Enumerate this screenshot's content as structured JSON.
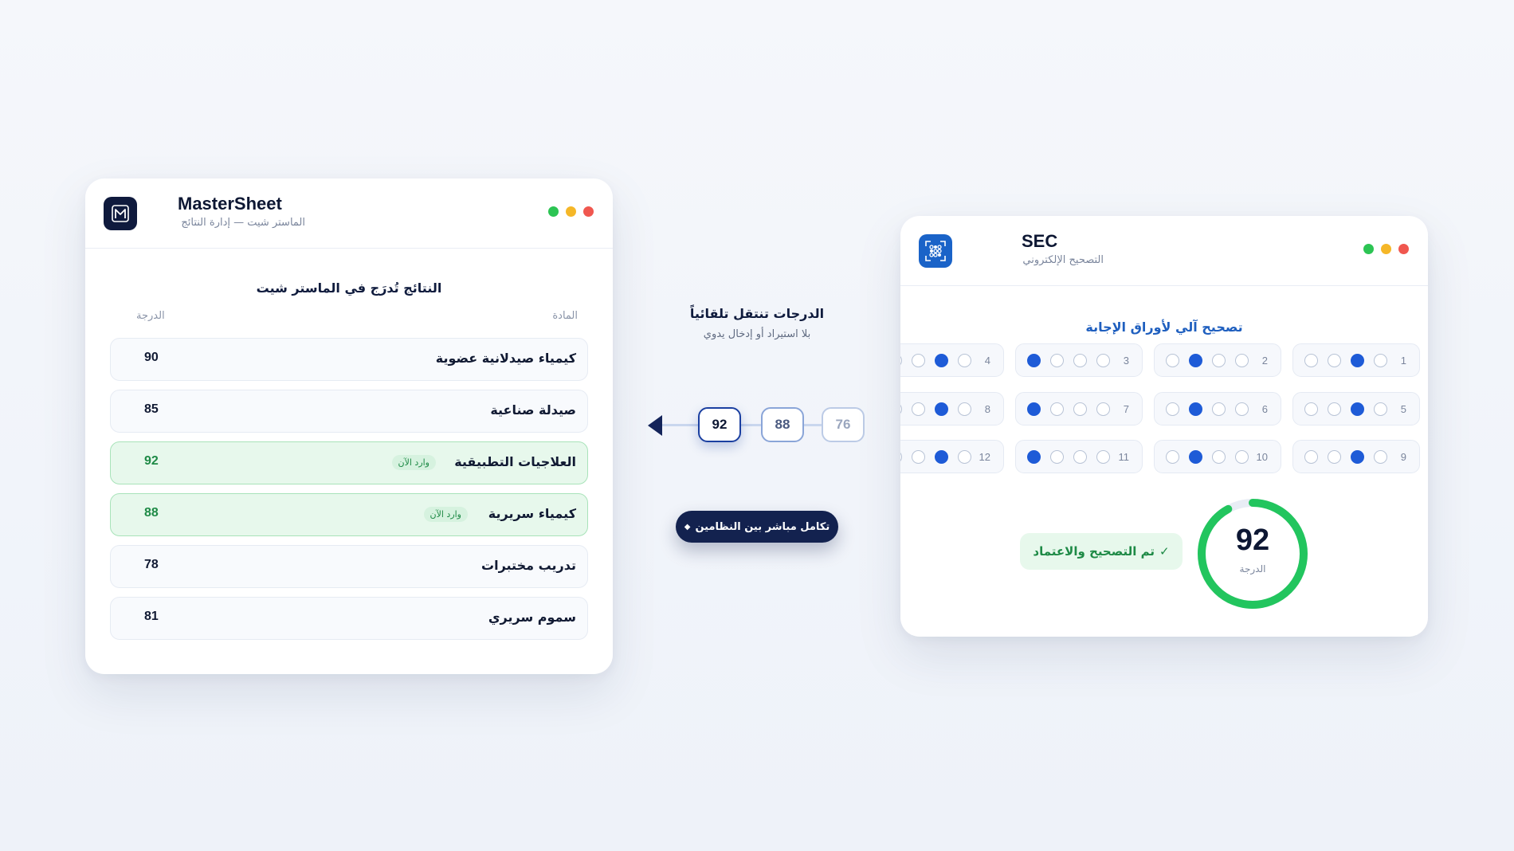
{
  "mastersheet": {
    "title": "MasterSheet",
    "subtitle": "الماستر شيت — إدارة النتائج",
    "icon": "mastersheet-logo-icon",
    "heading": "النتائج تُدرَج في الماستر شيت",
    "col_subject": "المادة",
    "col_grade": "الدرجة",
    "rows": [
      {
        "subject": "كيمياء صيدلانية عضوية",
        "grade": "90",
        "badge": ""
      },
      {
        "subject": "صيدلة صناعية",
        "grade": "85",
        "badge": ""
      },
      {
        "subject": "العلاجيات التطبيقية",
        "grade": "92",
        "badge": "وارد الآن"
      },
      {
        "subject": "كيمياء سريرية",
        "grade": "88",
        "badge": "وارد الآن"
      },
      {
        "subject": "تدريب مختبرات",
        "grade": "78",
        "badge": ""
      },
      {
        "subject": "سموم سريري",
        "grade": "81",
        "badge": ""
      }
    ]
  },
  "flow": {
    "title": "الدرجات تنتقل تلقائياً",
    "subtitle": "بلا استيراد أو إدخال يدوي",
    "chips": [
      "92",
      "88",
      "76"
    ],
    "integration_label": "تكامل مباشر بين النظامين",
    "integration_icon": "diamond-icon"
  },
  "sec": {
    "title": "SEC",
    "subtitle": "التصحيح الإلكتروني",
    "icon": "scan-grid-icon",
    "heading": "تصحيح آلي لأوراق الإجابة",
    "questions": [
      {
        "num": "1",
        "selected": 2
      },
      {
        "num": "2",
        "selected": 1
      },
      {
        "num": "3",
        "selected": 0
      },
      {
        "num": "4",
        "selected": 2
      },
      {
        "num": "5",
        "selected": 2
      },
      {
        "num": "6",
        "selected": 1
      },
      {
        "num": "7",
        "selected": 0
      },
      {
        "num": "8",
        "selected": 2
      },
      {
        "num": "9",
        "selected": 2
      },
      {
        "num": "10",
        "selected": 1
      },
      {
        "num": "11",
        "selected": 0
      },
      {
        "num": "12",
        "selected": 2
      }
    ],
    "approve_label": "تم التصحيح والاعتماد",
    "approve_icon": "checkmark-icon",
    "score": "92",
    "score_label": "الدرجة",
    "score_fraction": 0.92
  },
  "colors": {
    "navy": "#13224f",
    "accent_blue": "#1e5bd7",
    "success_green": "#22c55e",
    "success_text": "#1e8a46",
    "new_row_bg": "#e7f8ec"
  }
}
